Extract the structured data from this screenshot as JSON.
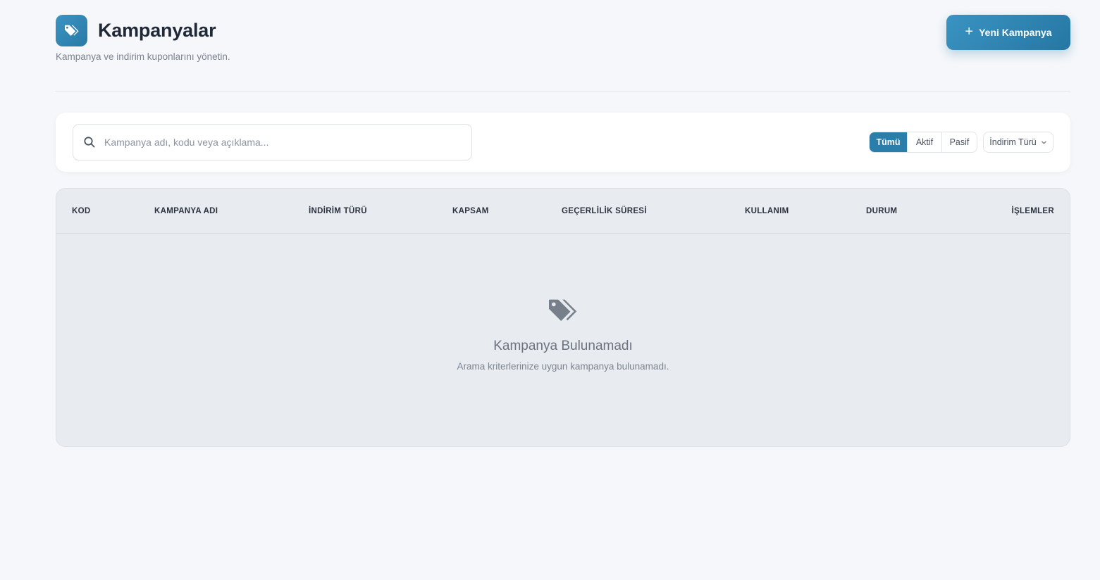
{
  "header": {
    "title": "Kampanyalar",
    "subtitle": "Kampanya ve indirim kuponlarını yönetin.",
    "title_icon": "tags-icon",
    "new_button_label": "Yeni Kampanya"
  },
  "filters": {
    "search_placeholder": "Kampanya adı, kodu veya açıklama...",
    "search_value": "",
    "status_options": [
      "Tümü",
      "Aktif",
      "Pasif"
    ],
    "status_selected": "Tümü",
    "type_select_label": "İndirim Türü"
  },
  "table": {
    "columns": [
      "KOD",
      "KAMPANYA ADI",
      "İNDİRİM TÜRÜ",
      "KAPSAM",
      "GEÇERLİLİK SÜRESİ",
      "KULLANIM",
      "DURUM",
      "İŞLEMLER"
    ],
    "rows": []
  },
  "empty_state": {
    "icon": "tags-icon",
    "title": "Kampanya Bulunamadı",
    "text": "Arama kriterlerinize uygun kampanya bulunamadı."
  },
  "colors": {
    "accent": "#2a7ea9",
    "background": "#f5f7fa",
    "table_bg": "#e8ebef"
  }
}
